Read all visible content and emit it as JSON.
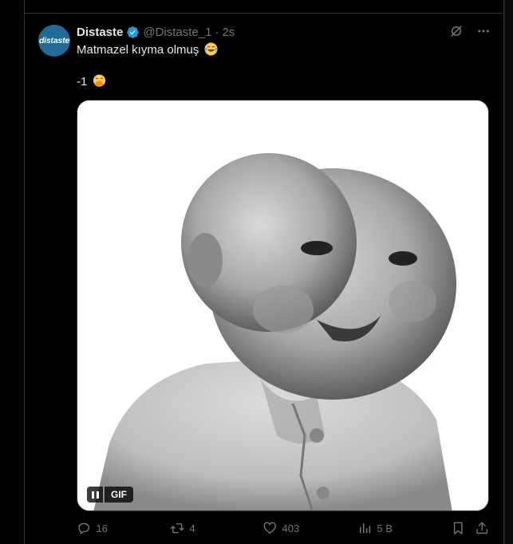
{
  "tweet": {
    "avatar_text": "distaste",
    "display_name": "Distaste",
    "handle": "@Distaste_1",
    "separator": "·",
    "time": "2s",
    "text_line1": "Matmazel kıyma olmuş",
    "text_line1_emoji": "face-with-tears-of-joy",
    "text_line2": "-1",
    "text_line2_emoji": "face-with-hand-over-mouth",
    "media": {
      "type": "GIF",
      "badge_label": "GIF",
      "description_icon": "pause-icon"
    },
    "actions": {
      "replies": "16",
      "retweets": "4",
      "likes": "403",
      "views": "5 B"
    }
  },
  "colors": {
    "background": "#000000",
    "text_primary": "#e7e9ea",
    "text_secondary": "#71767b",
    "border": "#2f3336",
    "verified": "#1d9bf0",
    "avatar_bg": "#1f6b96"
  }
}
